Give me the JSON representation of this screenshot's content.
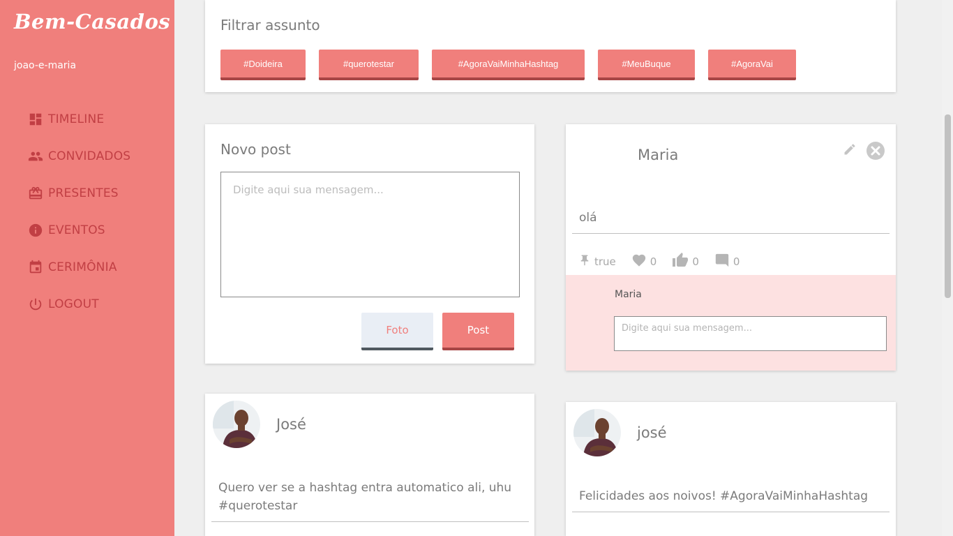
{
  "sidebar": {
    "brand": "Bem-Casados",
    "account": "joao-e-maria",
    "items": [
      {
        "label": "TIMELINE",
        "icon": "dashboard-icon"
      },
      {
        "label": "CONVIDADOS",
        "icon": "people-icon"
      },
      {
        "label": "PRESENTES",
        "icon": "gift-icon"
      },
      {
        "label": "EVENTOS",
        "icon": "info-icon"
      },
      {
        "label": "CERIMÔNIA",
        "icon": "calendar-icon"
      },
      {
        "label": "LOGOUT",
        "icon": "power-icon"
      }
    ]
  },
  "filter": {
    "title": "Filtrar assunto",
    "tags": [
      "#Doideira",
      "#querotestar",
      "#AgoraVaiMinhaHashtag",
      "#MeuBuque",
      "#AgoraVai"
    ]
  },
  "new_post": {
    "title": "Novo post",
    "placeholder": "Digite aqui sua mensagem...",
    "foto_label": "Foto",
    "post_label": "Post"
  },
  "posts": [
    {
      "author": "Maria",
      "text": "olá",
      "pinned": "true",
      "likes": "0",
      "thumbs": "0",
      "comments": "0",
      "comment_author": "Maria",
      "comment_placeholder": "Digite aqui sua mensagem..."
    },
    {
      "author": "José",
      "text": "Quero ver se a hashtag entra automatico ali, uhu #querotestar"
    },
    {
      "author": "josé",
      "text": "Felicidades aos noivos! #AgoraVaiMinhaHashtag"
    }
  ],
  "colors": {
    "primary": "#f07f7c",
    "accent_dark": "#c13f44",
    "comment_bg": "#fde1e1"
  }
}
